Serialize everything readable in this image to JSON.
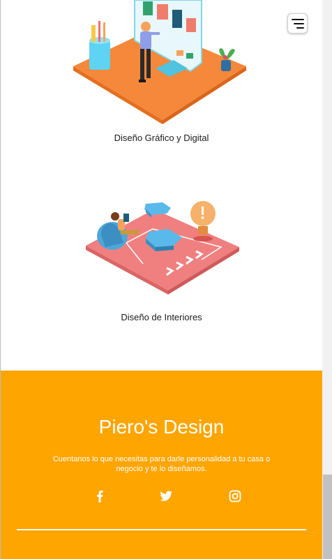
{
  "services": [
    {
      "title": "Diseño Gráfico y Digital"
    },
    {
      "title": "Diseño de Interiores"
    }
  ],
  "footer": {
    "brand": "Piero's Design",
    "description": "Cuentanos lo que necesitas para darle personalidad a tu casa o negocio y te lo diseñamos.",
    "social": [
      "facebook-icon",
      "twitter-icon",
      "instagram-icon"
    ],
    "background_color": "#ffa500"
  },
  "menu": {
    "icon": "hamburger-menu-icon"
  }
}
